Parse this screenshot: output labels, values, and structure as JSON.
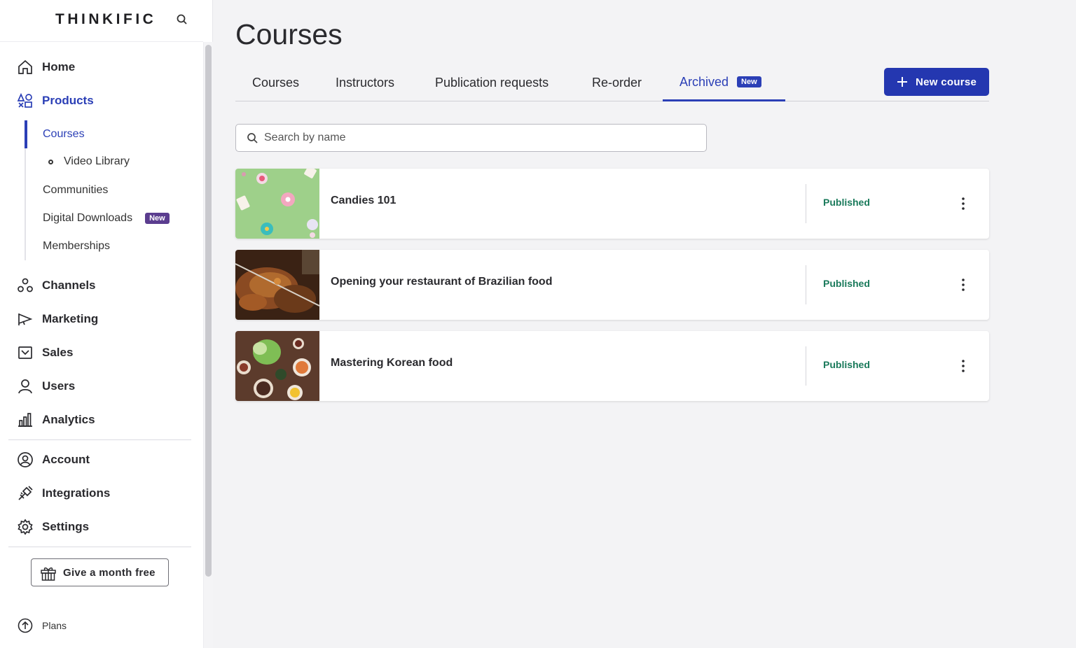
{
  "sidebar": {
    "logo": "THINKIFIC",
    "nav": {
      "home": "Home",
      "products": "Products",
      "channels": "Channels",
      "marketing": "Marketing",
      "sales": "Sales",
      "users": "Users",
      "analytics": "Analytics",
      "account": "Account",
      "integrations": "Integrations",
      "settings": "Settings"
    },
    "products_sub": {
      "courses": "Courses",
      "video_library": "Video Library",
      "communities": "Communities",
      "digital_downloads": "Digital Downloads",
      "digital_downloads_badge": "New",
      "memberships": "Memberships"
    },
    "gift_button": "Give a month free",
    "plans": "Plans"
  },
  "main": {
    "title": "Courses",
    "tabs": [
      {
        "label": "Courses"
      },
      {
        "label": "Instructors"
      },
      {
        "label": "Publication requests"
      },
      {
        "label": "Re-order"
      },
      {
        "label": "Archived",
        "badge": "New"
      }
    ],
    "active_tab": "Archived",
    "new_course_button": "New course",
    "search_placeholder": "Search by name",
    "courses": [
      {
        "title": "Candies 101",
        "status": "Published"
      },
      {
        "title": "Opening your restaurant of Brazilian food",
        "status": "Published"
      },
      {
        "title": "Mastering Korean food",
        "status": "Published"
      }
    ]
  },
  "colors": {
    "accent": "#2b3fb6",
    "primary_button": "#2437b0",
    "status_published": "#1a7a5b",
    "badge_purple": "#5b3d8f"
  }
}
